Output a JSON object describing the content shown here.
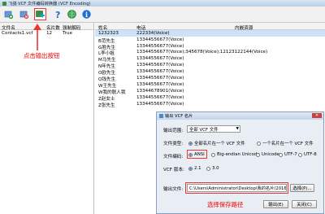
{
  "titlebar": {
    "title": "飞鸽 VCF 文件编码转换器 (VCF Encoding)"
  },
  "toolbar": {
    "buttons": [
      "open-icon",
      "delete-icon",
      "export-icon",
      "help-icon",
      "globe-icon",
      "info-icon"
    ]
  },
  "files": {
    "headers": [
      "文件名",
      "名片数",
      "强制解码"
    ],
    "rows": [
      {
        "name": "Contacts1.vcf",
        "count": "12",
        "force": "True"
      }
    ]
  },
  "contacts": {
    "headers": [
      "姓名",
      "电话",
      "内嵌资源"
    ],
    "rows": [
      {
        "name": "1232323",
        "phone": "222334(Voice)"
      },
      {
        "name": "B范先生",
        "phone": "13344556677(Voice)"
      },
      {
        "name": "G胜先生",
        "phone": "13344556677(Voice)"
      },
      {
        "name": "L李小姐",
        "phone": "13344556677(Voice);345678(Voice);12123122144(Voice)"
      },
      {
        "name": "M马先生",
        "phone": "13344556677(Voice)"
      },
      {
        "name": "N年先生",
        "phone": "13344556677(Voice)"
      },
      {
        "name": "O欧先生",
        "phone": "13344556677(Voice)"
      },
      {
        "name": "Q钱先生",
        "phone": "13344556677(Voice)"
      },
      {
        "name": "W王先生",
        "phone": "13344556677(Voice)"
      },
      {
        "name": "W我的联人我",
        "phone": "13344678901(Voice)"
      },
      {
        "name": "Z赵女士",
        "phone": "13344556677(Voice)"
      },
      {
        "name": "Z张先生",
        "phone": "13344556677(Voice)"
      }
    ]
  },
  "annotations": {
    "click_export": "点击输出按钮",
    "choose_path": "选择保存路径"
  },
  "dialog": {
    "title": "输出 VCF 名片",
    "close": "✕",
    "range_label": "输出范围:",
    "range_value": "全部 VCF 文件",
    "filetype_label": "文件类型:",
    "filetype_opt1": "全部名片在一个 VCF 文件",
    "filetype_opt2": "一个名片在一个 VCF 文件",
    "encoding_label": "文件编码:",
    "enc_ansi": "ANSI",
    "enc_big": "Big-endian Unicode",
    "enc_unicode": "Unicode",
    "enc_utf7": "UTF-7",
    "enc_utf8": "UTF-8",
    "version_label": "VCF 版本:",
    "ver_21": "2.1",
    "ver_30": "3.0",
    "output_label": "输出文件:",
    "output_path": "C:\\Users\\Administrator\\Desktop\\我的名片(20160725175335).vcf",
    "browse": "选择(P)...",
    "export": "输出(E)",
    "close_btn": "关闭(C)"
  },
  "colors": {
    "accent": "#e33333",
    "selection": "#cde2f8"
  }
}
